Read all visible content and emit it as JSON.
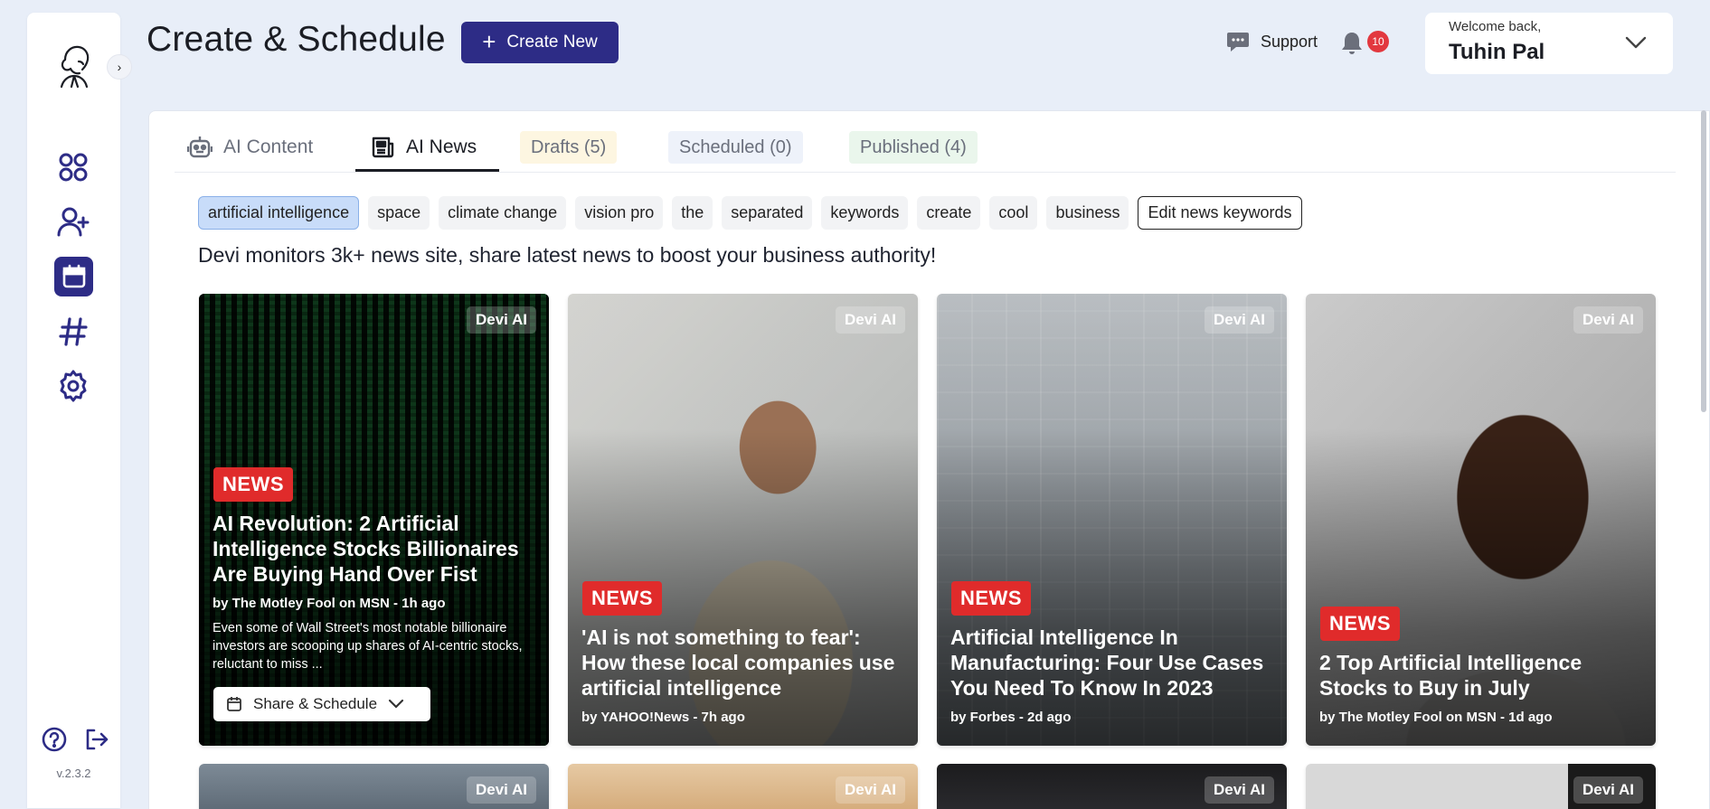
{
  "app": {
    "version": "v.2.3.2",
    "page_title": "Create & Schedule",
    "create_button": "Create New",
    "support_label": "Support",
    "notifications_count": "10",
    "user": {
      "welcome": "Welcome back,",
      "name": "Tuhin Pal"
    }
  },
  "sidebar": {
    "items": [
      {
        "name": "dashboard",
        "icon": "grid-icon"
      },
      {
        "name": "add-user",
        "icon": "user-plus-icon"
      },
      {
        "name": "schedule",
        "icon": "calendar-icon",
        "active": true
      },
      {
        "name": "hashtags",
        "icon": "hashtag-icon"
      },
      {
        "name": "settings",
        "icon": "gear-icon"
      }
    ],
    "bottom": [
      "help-icon",
      "logout-icon"
    ]
  },
  "tabs": {
    "ai_content": "AI Content",
    "ai_news": "AI News",
    "drafts": "Drafts (5)",
    "scheduled": "Scheduled (0)",
    "published": "Published (4)"
  },
  "keywords": [
    "artificial intelligence",
    "space",
    "climate change",
    "vision pro",
    "the",
    "separated",
    "keywords",
    "create",
    "cool",
    "business"
  ],
  "edit_keywords_label": "Edit news keywords",
  "subtitle": "Devi monitors 3k+ news site, share latest news to boost your business authority!",
  "cards": [
    {
      "badge": "Devi AI",
      "tag": "NEWS",
      "title": "AI Revolution: 2 Artificial Intelligence Stocks Billionaires Are Buying Hand Over Fist",
      "source": "by The Motley Fool on MSN - 1h ago",
      "description": "Even some of Wall Street's most notable billionaire investors are scooping up shares of AI-centric stocks, reluctant to miss ...",
      "share_label": "Share & Schedule"
    },
    {
      "badge": "Devi AI",
      "tag": "NEWS",
      "title": "'AI is not something to fear': How these local companies use artificial intelligence",
      "source": "by YAHOO!News - 7h ago"
    },
    {
      "badge": "Devi AI",
      "tag": "NEWS",
      "title": "Artificial Intelligence In Manufacturing: Four Use Cases You Need To Know In 2023",
      "source": "by Forbes - 2d ago"
    },
    {
      "badge": "Devi AI",
      "tag": "NEWS",
      "title": "2 Top Artificial Intelligence Stocks to Buy in July",
      "source": "by The Motley Fool on MSN - 1d ago"
    }
  ],
  "next_row_badges": [
    "Devi AI",
    "Devi AI",
    "Devi AI",
    "Devi AI"
  ],
  "colors": {
    "brand": "#2d2c86",
    "news_tag": "#e02b2b",
    "notification": "#e2383f",
    "active_chip": "#c8dcf9",
    "background": "#e8eef8"
  }
}
